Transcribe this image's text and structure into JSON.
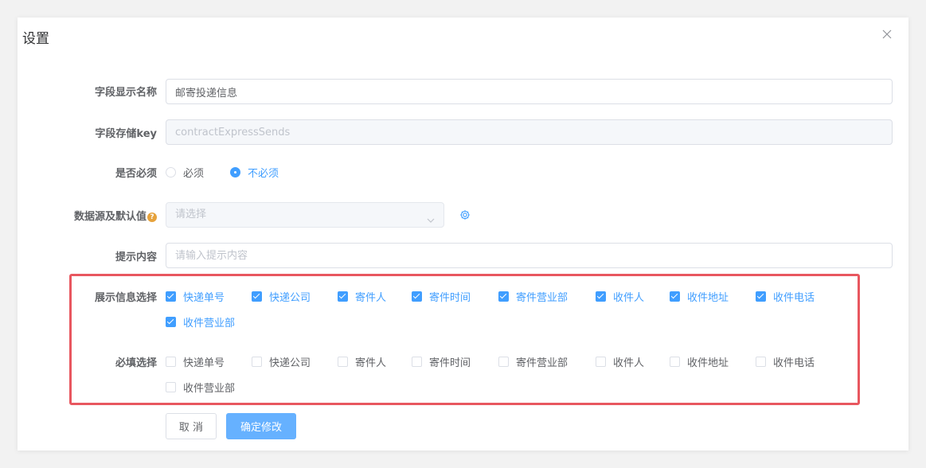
{
  "dialog": {
    "title": "设置",
    "close_icon": "close-icon"
  },
  "form": {
    "display_name": {
      "label": "字段显示名称",
      "value": "邮寄投递信息"
    },
    "storage_key": {
      "label": "字段存储key",
      "value": "contractExpressSends"
    },
    "required": {
      "label": "是否必须",
      "options": [
        {
          "label": "必须",
          "checked": false
        },
        {
          "label": "不必须",
          "checked": true
        }
      ]
    },
    "datasource": {
      "label": "数据源及默认值",
      "help_icon": "?",
      "placeholder": "请选择"
    },
    "hint": {
      "label": "提示内容",
      "placeholder": "请输入提示内容"
    },
    "display_select": {
      "label": "展示信息选择",
      "items": [
        {
          "label": "快递单号",
          "checked": true
        },
        {
          "label": "快递公司",
          "checked": true
        },
        {
          "label": "寄件人",
          "checked": true
        },
        {
          "label": "寄件时间",
          "checked": true
        },
        {
          "label": "寄件营业部",
          "checked": true
        },
        {
          "label": "收件人",
          "checked": true
        },
        {
          "label": "收件地址",
          "checked": true
        },
        {
          "label": "收件电话",
          "checked": true
        },
        {
          "label": "收件营业部",
          "checked": true
        }
      ]
    },
    "required_select": {
      "label": "必填选择",
      "items": [
        {
          "label": "快递单号",
          "checked": false
        },
        {
          "label": "快递公司",
          "checked": false
        },
        {
          "label": "寄件人",
          "checked": false
        },
        {
          "label": "寄件时间",
          "checked": false
        },
        {
          "label": "寄件营业部",
          "checked": false
        },
        {
          "label": "收件人",
          "checked": false
        },
        {
          "label": "收件地址",
          "checked": false
        },
        {
          "label": "收件电话",
          "checked": false
        },
        {
          "label": "收件营业部",
          "checked": false
        }
      ]
    }
  },
  "footer": {
    "cancel_label": "取 消",
    "confirm_label": "确定修改"
  },
  "colors": {
    "primary": "#409eff",
    "highlight_border": "#e8575f",
    "help_icon": "#e6a23c"
  }
}
